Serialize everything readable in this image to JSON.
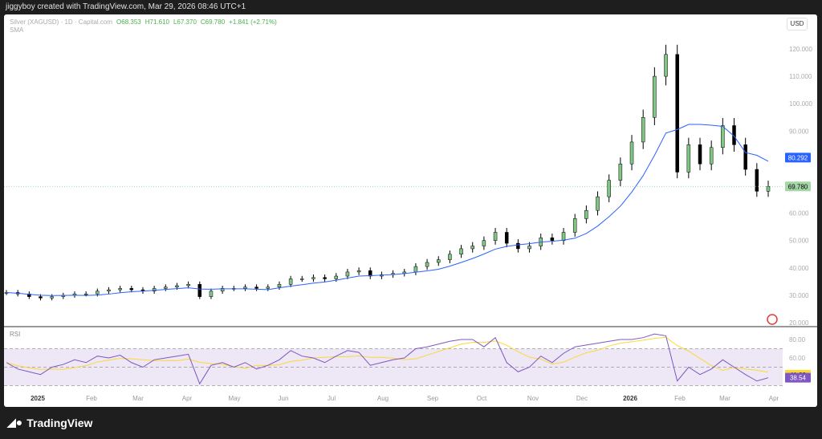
{
  "header": {
    "text": "jiggyboy created with TradingView.com, Mar 29, 2026 08:46 UTC+1"
  },
  "legend": {
    "symbol": "Silver (XAGUSD) · 1D · Capital.com",
    "open": "O68.353",
    "high": "H71.610",
    "low": "L67.370",
    "close": "C69.780",
    "change": "+1.841 (+2.71%)",
    "sma": "SMA",
    "rsi": "RSI"
  },
  "currency": "USD",
  "footer": {
    "brand": "TradingView"
  },
  "colors": {
    "up": "#81c784",
    "down": "#000000",
    "sma": "#2962ff",
    "rsi": "#7e57c2",
    "rsi_ma": "#fdd835",
    "price_tag": "#a5d6a7"
  },
  "chart_data": {
    "type": "candlestick",
    "price_axis": {
      "ticks": [
        "120.000",
        "110.000",
        "100.000",
        "90.000",
        "80.000",
        "70.000",
        "60.000",
        "50.000",
        "40.000",
        "30.000",
        "20.000"
      ],
      "range": [
        20,
        120
      ]
    },
    "rsi_axis": {
      "ticks": [
        "80.00",
        "60.00"
      ],
      "levels": [
        70,
        50,
        30
      ]
    },
    "time_labels": [
      "2025",
      "Feb",
      "Mar",
      "Apr",
      "May",
      "Jun",
      "Jul",
      "Aug",
      "Sep",
      "Oct",
      "Nov",
      "Dec",
      "2026",
      "Feb",
      "Mar",
      "Apr"
    ],
    "weekly_closes": [
      31,
      30.5,
      29.5,
      29,
      29.5,
      30,
      30.5,
      30.5,
      31.5,
      32,
      32.5,
      32,
      31.5,
      32.5,
      33,
      33.5,
      34,
      29.5,
      31.5,
      32.5,
      32.5,
      33,
      32.5,
      33,
      34,
      36,
      36,
      36.5,
      36,
      37,
      38.5,
      39,
      37,
      37.5,
      38,
      38.5,
      40.5,
      42,
      43,
      45,
      47,
      48,
      50,
      53,
      49,
      47,
      48,
      51,
      50,
      53,
      58,
      61,
      66,
      72,
      78,
      86,
      95,
      110,
      118,
      75,
      85,
      78,
      84,
      92,
      85,
      76,
      68,
      69.78
    ],
    "rsi": [
      55,
      48,
      45,
      42,
      50,
      53,
      58,
      55,
      62,
      60,
      63,
      55,
      50,
      58,
      60,
      62,
      64,
      32,
      52,
      55,
      50,
      55,
      48,
      52,
      58,
      68,
      62,
      60,
      55,
      62,
      68,
      66,
      52,
      55,
      58,
      60,
      70,
      72,
      75,
      78,
      80,
      80,
      72,
      82,
      55,
      45,
      50,
      62,
      55,
      65,
      72,
      74,
      76,
      78,
      80,
      80,
      82,
      86,
      84,
      35,
      50,
      42,
      48,
      58,
      50,
      42,
      35,
      38.54
    ],
    "last_price": "69.780",
    "sma_last": "80.292",
    "rsi_last": "38.54",
    "rsi_ma_last": "41.83"
  }
}
